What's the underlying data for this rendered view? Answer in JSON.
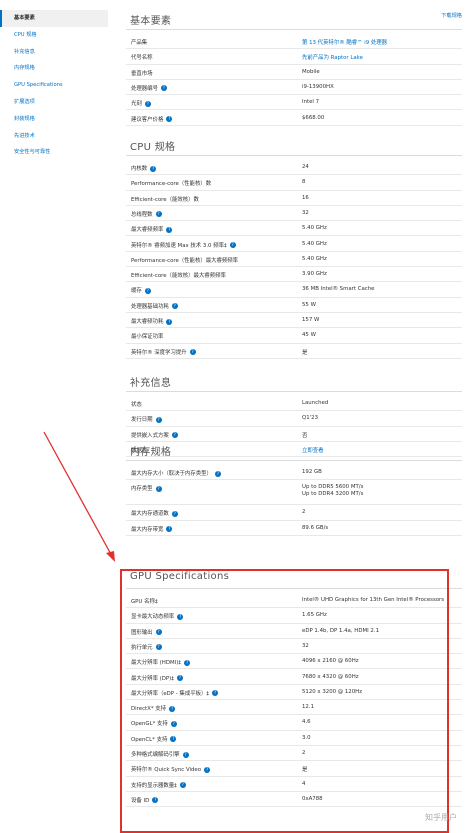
{
  "download_link": "下载规格",
  "sidebar": {
    "items": [
      {
        "label": "基本要素",
        "active": true
      },
      {
        "label": "CPU 规格",
        "active": false
      },
      {
        "label": "补充信息",
        "active": false
      },
      {
        "label": "内存规格",
        "active": false
      },
      {
        "label": "GPU Specifications",
        "active": false
      },
      {
        "label": "扩展选项",
        "active": false
      },
      {
        "label": "封装规格",
        "active": false
      },
      {
        "label": "先进技术",
        "active": false
      },
      {
        "label": "安全性与可靠性",
        "active": false
      }
    ]
  },
  "sections": [
    {
      "title": "基本要素",
      "rows": [
        {
          "label": "产品集",
          "value": [
            "第 13 代英特尔® 酷睿™ i9 处理器"
          ],
          "link": true
        },
        {
          "label": "代号名称",
          "value": [
            "先前产品为 Raptor Lake"
          ],
          "link": true
        },
        {
          "label": "垂直市场",
          "value": [
            "Mobile"
          ]
        },
        {
          "label": "处理器编号",
          "value": [
            "i9-13900HX"
          ],
          "help": true
        },
        {
          "label": "光刻",
          "value": [
            "Intel 7"
          ],
          "help": true
        },
        {
          "label": "建议客户价格",
          "value": [
            "$668.00"
          ],
          "help": true
        }
      ]
    },
    {
      "title": "CPU 规格",
      "rows": [
        {
          "label": "内核数",
          "value": [
            "24"
          ],
          "help": true
        },
        {
          "label": "Performance-core（性能核）数",
          "value": [
            "8"
          ]
        },
        {
          "label": "Efficient-core（能效核）数",
          "value": [
            "16"
          ]
        },
        {
          "label": "总线程数",
          "value": [
            "32"
          ],
          "help": true
        },
        {
          "label": "最大睿频频率",
          "value": [
            "5.40 GHz"
          ],
          "help": true
        },
        {
          "label": "英特尔® 睿频加速 Max 技术 3.0 频率‡",
          "value": [
            "5.40 GHz"
          ],
          "help": true
        },
        {
          "label": "Performance-core（性能核）最大睿频频率",
          "value": [
            "5.40 GHz"
          ]
        },
        {
          "label": "Efficient-core（能效核）最大睿频频率",
          "value": [
            "3.90 GHz"
          ]
        },
        {
          "label": "缓存",
          "value": [
            "36 MB Intel® Smart Cache"
          ],
          "help": true
        },
        {
          "label": "处理器基础功耗",
          "value": [
            "55 W"
          ],
          "help": true
        },
        {
          "label": "最大睿频功耗",
          "value": [
            "157 W"
          ],
          "help": true
        },
        {
          "label": "最小保证功率",
          "value": [
            "45 W"
          ]
        },
        {
          "label": "英特尔® 深度学习提升",
          "value": [
            "是"
          ],
          "help": true
        }
      ]
    },
    {
      "title": "补充信息",
      "rows": [
        {
          "label": "状态",
          "value": [
            "Launched"
          ]
        },
        {
          "label": "发行日期",
          "value": [
            "Q1'23"
          ],
          "help": true
        },
        {
          "label": "提供嵌入式方案",
          "value": [
            "否"
          ],
          "help": true
        },
        {
          "label": "数据表",
          "value": [
            "立即查看"
          ],
          "link": true
        }
      ]
    },
    {
      "title": "内存规格",
      "rows": [
        {
          "label": "最大内存大小（取决于内存类型）",
          "value": [
            "192 GB"
          ],
          "help": true
        },
        {
          "label": "内存类型",
          "value": [
            "Up to DDR5 5600 MT/s",
            "Up to DDR4 3200 MT/s"
          ],
          "help": true
        },
        {
          "label": "最大内存通道数",
          "value": [
            "2"
          ],
          "help": true
        },
        {
          "label": "最大内存带宽",
          "value": [
            "89.6 GB/s"
          ],
          "help": true
        }
      ]
    },
    {
      "title": "GPU Specifications",
      "rows": [
        {
          "label": "GPU 名称‡",
          "value": [
            "Intel® UHD Graphics for 13th Gen Intel® Processors"
          ]
        },
        {
          "label": "显卡最大动态频率",
          "value": [
            "1.65 GHz"
          ],
          "help": true
        },
        {
          "label": "图形输出",
          "value": [
            "eDP 1.4b, DP 1.4a, HDMI 2.1"
          ],
          "help": true
        },
        {
          "label": "执行单元",
          "value": [
            "32"
          ],
          "help": true
        },
        {
          "label": "最大分辨率 (HDMI)‡",
          "value": [
            "4096 x 2160 @ 60Hz"
          ],
          "help": true
        },
        {
          "label": "最大分辨率 (DP)‡",
          "value": [
            "7680 x 4320 @ 60Hz"
          ],
          "help": true
        },
        {
          "label": "最大分辨率（eDP - 集成平板）‡",
          "value": [
            "5120 x 3200 @ 120Hz"
          ],
          "help": true
        },
        {
          "label": "DirectX* 支持",
          "value": [
            "12.1"
          ],
          "help": true
        },
        {
          "label": "OpenGL* 支持",
          "value": [
            "4.6"
          ],
          "help": true
        },
        {
          "label": "OpenCL* 支持",
          "value": [
            "3.0"
          ],
          "help": true
        },
        {
          "label": "多种格式编解码引擎",
          "value": [
            "2"
          ],
          "help": true
        },
        {
          "label": "英特尔® Quick Sync Video",
          "value": [
            "是"
          ],
          "help": true
        },
        {
          "label": "支持的显示器数量‡",
          "value": [
            "4"
          ],
          "help": true
        },
        {
          "label": "设备 ID",
          "value": [
            "0xA788"
          ],
          "help": true
        }
      ]
    }
  ],
  "watermark": "知乎用户",
  "colors": {
    "accent": "#0071c5",
    "highlight": "#e0312d"
  },
  "icons": {
    "help": "question-circle-icon"
  }
}
